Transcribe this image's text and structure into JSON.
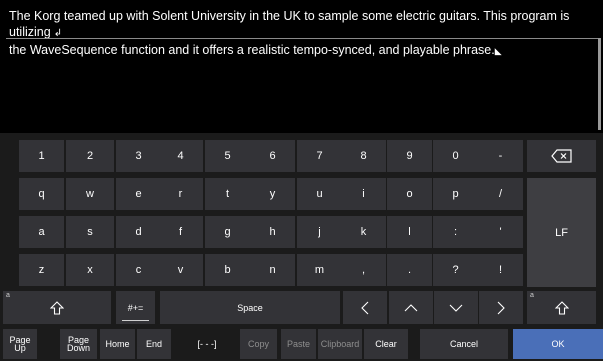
{
  "editor": {
    "text_line1": "The Korg teamed up with Solent University in the UK to sample some electric guitars. This program is utilizing",
    "text_line2": "the WaveSequence function and it offers a realistic tempo-synced, and playable phrase."
  },
  "keyboard": {
    "row1": [
      "1",
      "2",
      "3",
      "4",
      "5",
      "6",
      "7",
      "8",
      "9",
      "0",
      "-"
    ],
    "row2": [
      "q",
      "w",
      "e",
      "r",
      "t",
      "y",
      "u",
      "i",
      "o",
      "p",
      "/"
    ],
    "row3": [
      "a",
      "s",
      "d",
      "f",
      "g",
      "h",
      "j",
      "k",
      "l",
      ":",
      "'"
    ],
    "row4": [
      "z",
      "x",
      "c",
      "v",
      "b",
      "n",
      "m",
      ",",
      ".",
      "?",
      "!"
    ],
    "symbols_label": "#+=",
    "space_label": "Space",
    "lf_label": "LF",
    "bottom": {
      "page_up_1": "Page",
      "page_up_2": "Up",
      "page_down_1": "Page",
      "page_down_2": "Down",
      "home": "Home",
      "end": "End",
      "select": "[- - -]",
      "copy": "Copy",
      "paste": "Paste",
      "clipboard": "Clipboard",
      "clear": "Clear",
      "cancel": "Cancel",
      "ok": "OK"
    }
  },
  "colors": {
    "key_bg": "#333337",
    "keyboard_bg": "#1b1b1b",
    "ok_bg": "#4a6fb8",
    "disabled_text": "#8e8e8e"
  }
}
